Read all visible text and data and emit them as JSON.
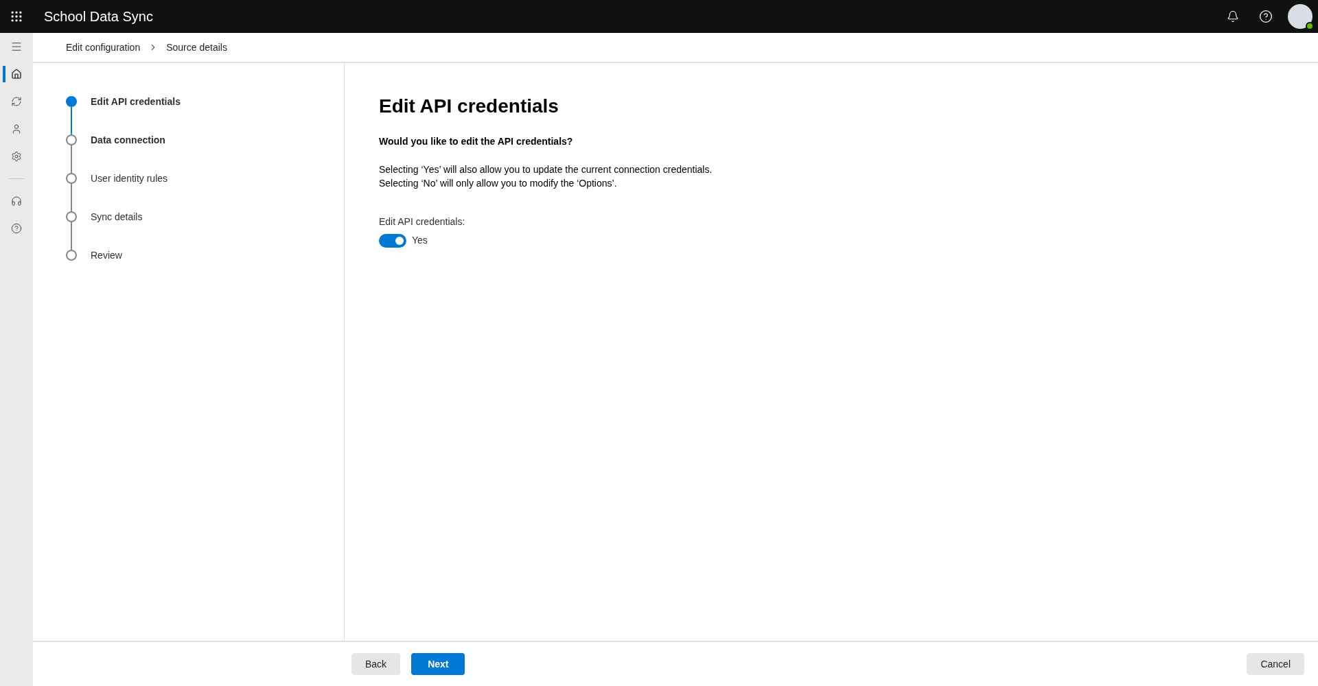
{
  "app": {
    "title": "School Data Sync"
  },
  "nav_rail": {
    "items": [
      {
        "selected": true
      },
      {
        "selected": false
      },
      {
        "selected": false
      },
      {
        "selected": false
      },
      {
        "selected": false
      },
      {
        "selected": false
      }
    ]
  },
  "breadcrumb": [
    "Edit configuration",
    "Source details"
  ],
  "steps": [
    {
      "label": "Edit API credentials",
      "selected": true,
      "bold": true
    },
    {
      "label": "Data connection",
      "selected": false,
      "bold": true
    },
    {
      "label": "User identity rules",
      "selected": false,
      "bold": false
    },
    {
      "label": "Sync details",
      "selected": false,
      "bold": false
    },
    {
      "label": "Review",
      "selected": false,
      "bold": false
    }
  ],
  "content": {
    "heading": "Edit API credentials",
    "question": "Would you like to edit the API credentials?",
    "description": [
      "Selecting ‘Yes’ will also allow you to update the current connection credentials.",
      "Selecting ‘No’ will only allow you to modify the ‘Options’."
    ],
    "toggle": {
      "label": "Edit API credentials:",
      "on": true,
      "state_text": "Yes"
    }
  },
  "footer": {
    "back": "Back",
    "next": "Next",
    "cancel": "Cancel"
  }
}
